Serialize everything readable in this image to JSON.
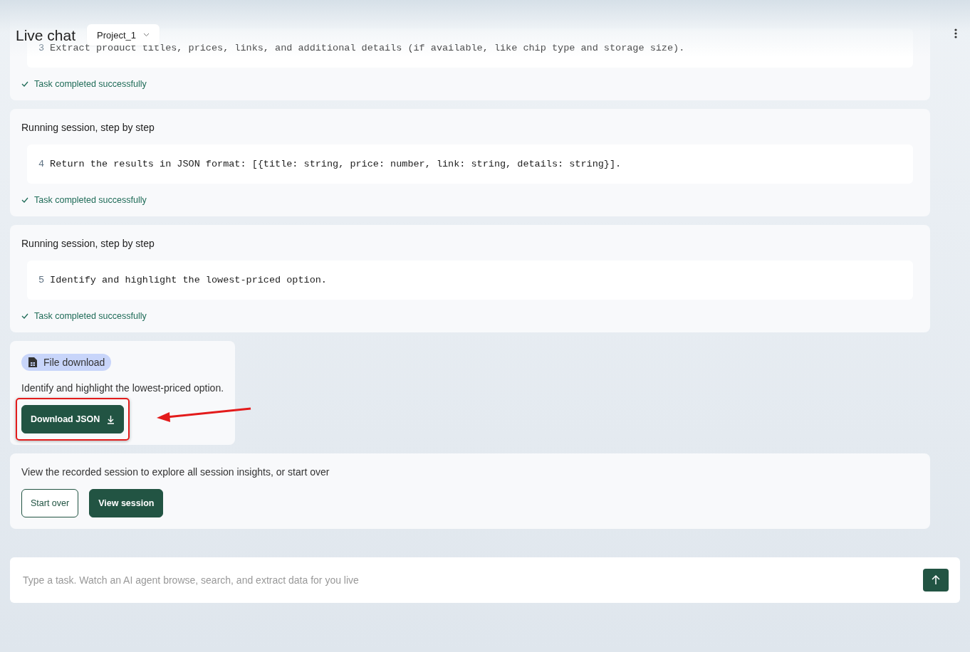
{
  "header": {
    "title": "Live chat",
    "project": "Project_1"
  },
  "steps": [
    {
      "number": "3",
      "code": "Extract product titles, prices, links, and additional details (if available, like chip type and storage size).",
      "status": "Task completed successfully",
      "done": true
    },
    {
      "title": "Running session, step by step",
      "number": "4",
      "code": "Return the results in JSON format: [{title: string, price: number, link: string, details: string}].",
      "status": "Task completed successfully",
      "done": true
    },
    {
      "title": "Running session, step by step",
      "number": "5",
      "code": "Identify and highlight the lowest-priced option.",
      "status": "Task completed successfully",
      "done": true
    }
  ],
  "download": {
    "badge": "File download",
    "text": "Identify and highlight the lowest-priced option.",
    "button": "Download JSON",
    "highlighted": true
  },
  "session": {
    "text": "View the recorded session to explore all session insights, or start over",
    "buttons": [
      {
        "label": "Start over",
        "kind": "outline"
      },
      {
        "label": "View session",
        "kind": "filled"
      }
    ]
  },
  "composer": {
    "placeholder": "Type a task. Watch an AI agent browse, search, and extract data for you live"
  }
}
